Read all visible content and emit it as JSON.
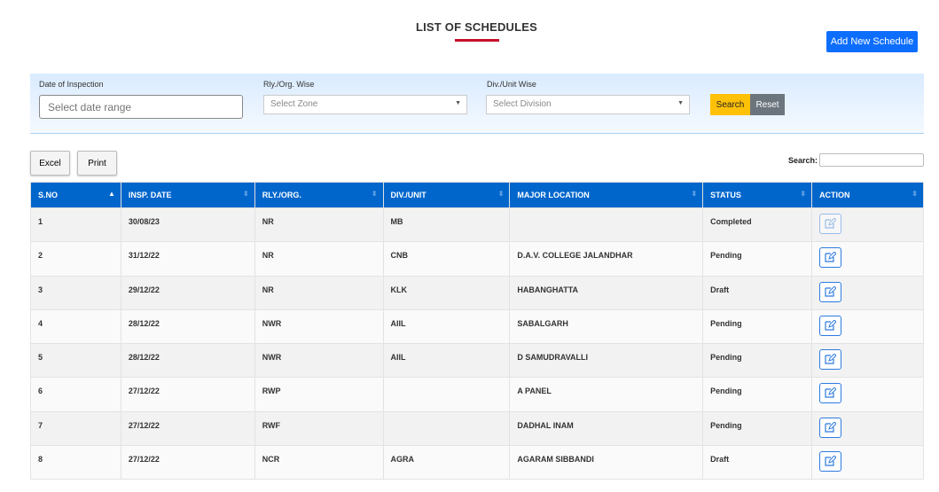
{
  "page": {
    "title": "LIST OF SCHEDULES",
    "add_button": "Add New Schedule"
  },
  "filters": {
    "date_label": "Date of Inspection",
    "date_placeholder": "Select date range",
    "zone_label": "Rly./Org. Wise",
    "zone_value": "Select Zone",
    "division_label": "Div./Unit Wise",
    "division_value": "Select Division",
    "search_button": "Search",
    "reset_button": "Reset"
  },
  "toolbar": {
    "excel": "Excel",
    "print": "Print",
    "search_label": "Search:"
  },
  "colors": {
    "header": "#0066cc",
    "accent": "#c8102e",
    "search_button": "#ffc107",
    "reset_button": "#6c757d"
  },
  "table": {
    "columns": [
      "S.NO",
      "INSP. DATE",
      "RLY./ORG.",
      "DIV./UNIT",
      "MAJOR LOCATION",
      "STATUS",
      "ACTION"
    ],
    "rows": [
      {
        "sno": "1",
        "date": "30/08/23",
        "rly": "NR",
        "div": "MB",
        "loc": "",
        "status": "Completed"
      },
      {
        "sno": "2",
        "date": "31/12/22",
        "rly": "NR",
        "div": "CNB",
        "loc": "D.A.V. COLLEGE JALANDHAR",
        "status": "Pending"
      },
      {
        "sno": "3",
        "date": "29/12/22",
        "rly": "NR",
        "div": "KLK",
        "loc": "HABANGHATTA",
        "status": "Draft"
      },
      {
        "sno": "4",
        "date": "28/12/22",
        "rly": "NWR",
        "div": "AIIL",
        "loc": "SABALGARH",
        "status": "Pending"
      },
      {
        "sno": "5",
        "date": "28/12/22",
        "rly": "NWR",
        "div": "AIIL",
        "loc": "D SAMUDRAVALLI",
        "status": "Pending"
      },
      {
        "sno": "6",
        "date": "27/12/22",
        "rly": "RWP",
        "div": "",
        "loc": "A PANEL",
        "status": "Pending"
      },
      {
        "sno": "7",
        "date": "27/12/22",
        "rly": "RWF",
        "div": "",
        "loc": "DADHAL INAM",
        "status": "Pending"
      },
      {
        "sno": "8",
        "date": "27/12/22",
        "rly": "NCR",
        "div": "AGRA",
        "loc": "AGARAM SIBBANDI",
        "status": "Draft"
      }
    ]
  }
}
